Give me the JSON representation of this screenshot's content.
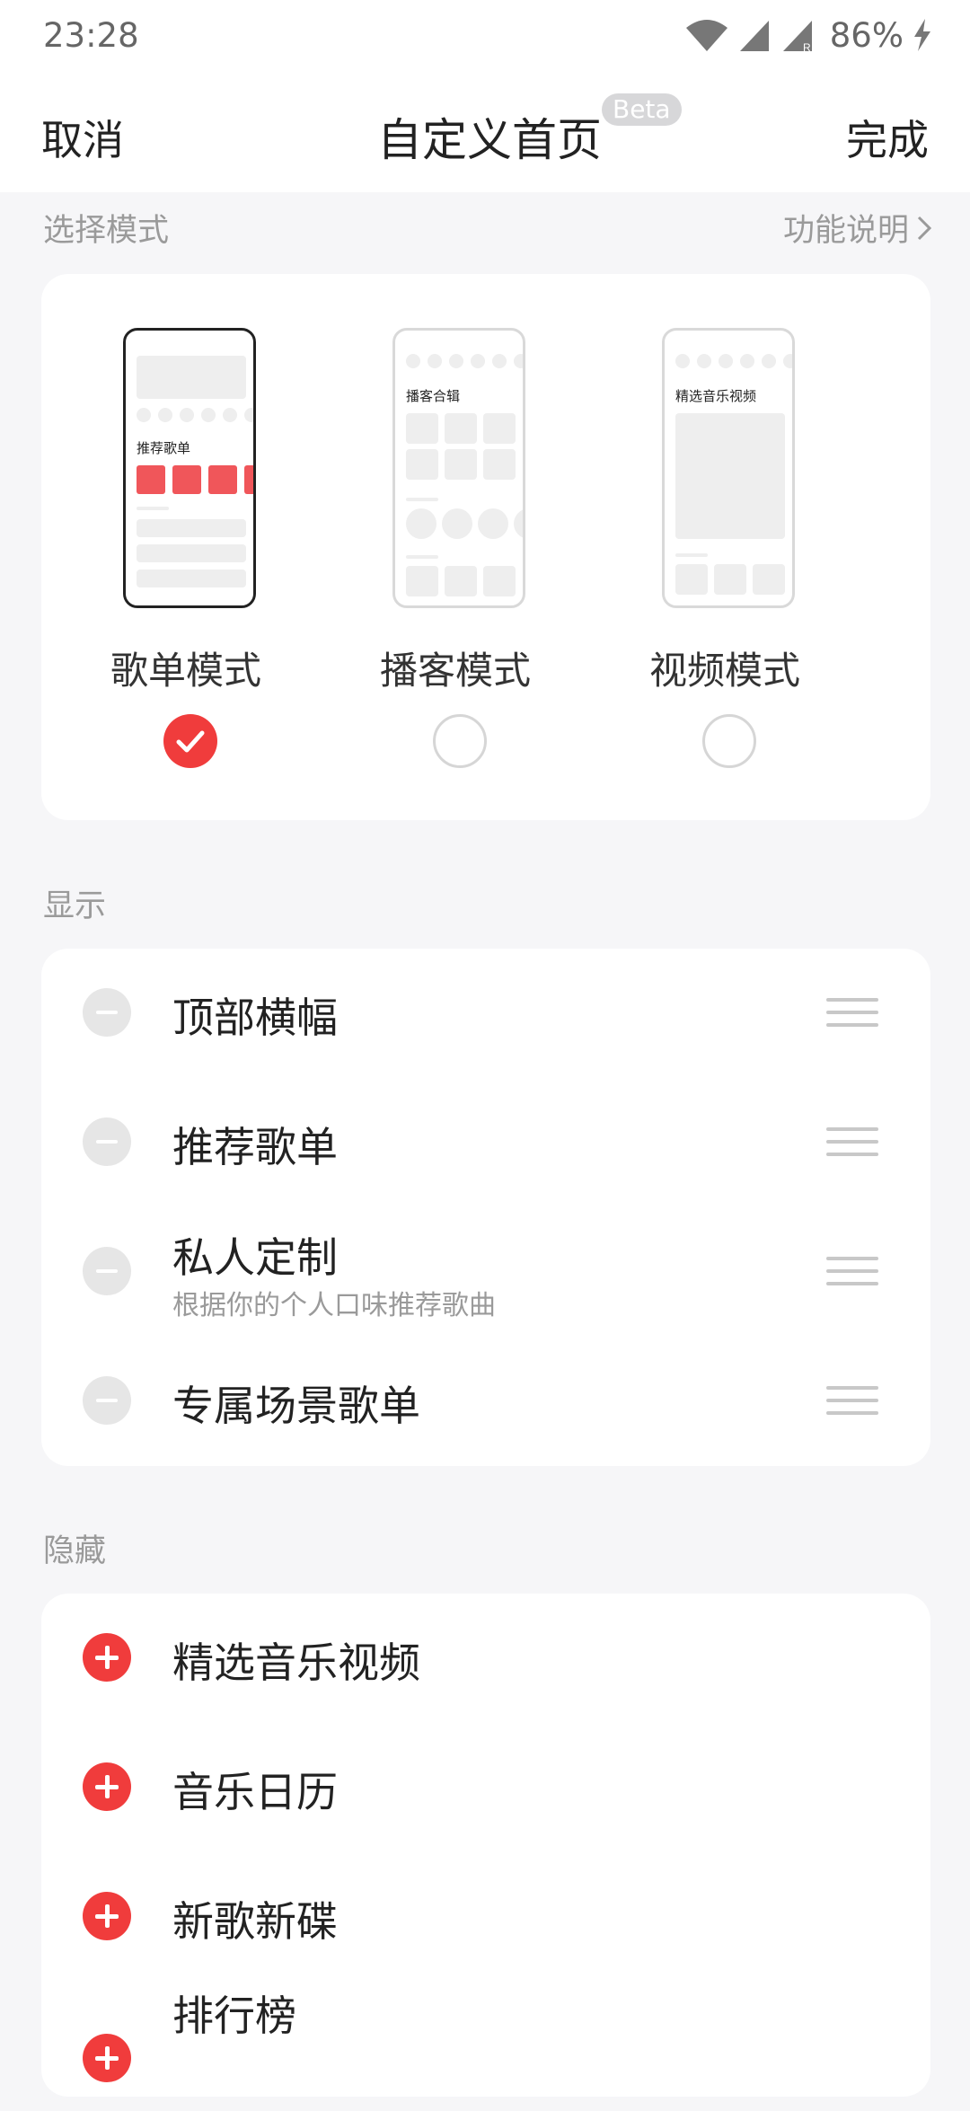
{
  "status": {
    "time": "23:28",
    "battery": "86%"
  },
  "nav": {
    "cancel": "取消",
    "title": "自定义首页",
    "beta": "Beta",
    "done": "完成"
  },
  "mode_section": {
    "label": "选择模式",
    "link": "功能说明",
    "modes": [
      {
        "label": "歌单模式",
        "selected": true,
        "preview_text": "推荐歌单"
      },
      {
        "label": "播客模式",
        "selected": false,
        "preview_text": "播客合辑"
      },
      {
        "label": "视频模式",
        "selected": false,
        "preview_text": "精选音乐视频"
      }
    ]
  },
  "display_section": {
    "label": "显示",
    "items": [
      {
        "name": "顶部横幅",
        "sub": ""
      },
      {
        "name": "推荐歌单",
        "sub": ""
      },
      {
        "name": "私人定制",
        "sub": "根据你的个人口味推荐歌曲"
      },
      {
        "name": "专属场景歌单",
        "sub": ""
      }
    ]
  },
  "hidden_section": {
    "label": "隐藏",
    "items": [
      {
        "name": "精选音乐视频"
      },
      {
        "name": "音乐日历"
      },
      {
        "name": "新歌新碟"
      },
      {
        "name": "排行榜"
      }
    ]
  },
  "colors": {
    "accent": "#f03c3c",
    "background": "#f6f6f8",
    "muted": "#9a9a9a"
  }
}
